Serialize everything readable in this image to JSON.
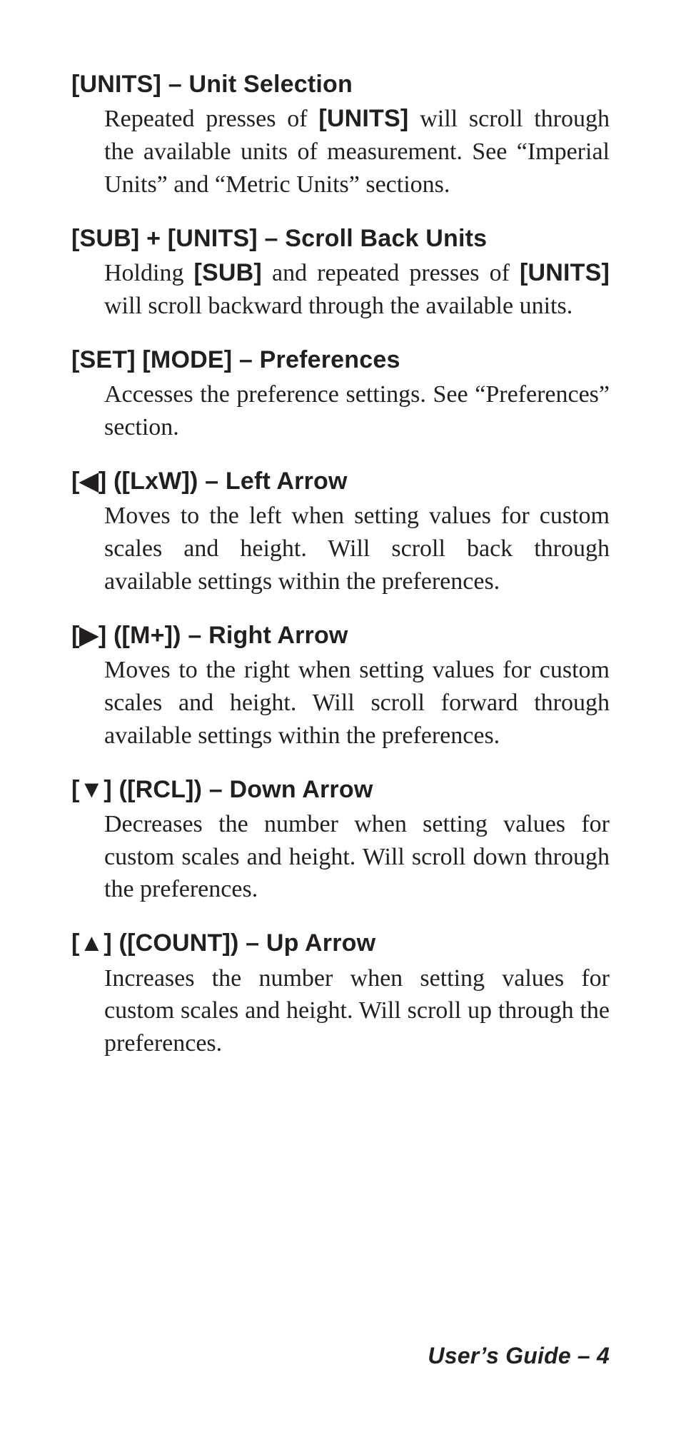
{
  "entries": [
    {
      "heading": "[UNITS] – Unit Selection",
      "body_html": "Repeated presses of <b>[UNITS]</b> will scroll through the available units of measurement. See “Imperial Units” and “Metric Units” sections."
    },
    {
      "heading": "[SUB] + [UNITS] – Scroll Back Units",
      "body_html": "Holding <b>[SUB]</b> and repeated presses of <b>[UNITS]</b> will scroll backward through the available units."
    },
    {
      "heading": "[SET] [MODE] – Preferences",
      "body_html": "Accesses the preference settings. See “Preferences” section."
    },
    {
      "heading": "[◀] ([LxW]) – Left Arrow",
      "body_html": "Moves to the left when setting values for custom scales and height. Will scroll back through available settings within the preferences."
    },
    {
      "heading": "[▶] ([M+]) – Right Arrow",
      "body_html": "Moves to the right when setting values for custom scales and height. Will scroll forward through available settings within the preferences."
    },
    {
      "heading": "[▼] ([RCL]) – Down Arrow",
      "body_html": "Decreases the number when setting values for custom scales and height. Will scroll down through the preferences."
    },
    {
      "heading": "[▲] ([COUNT]) – Up Arrow",
      "body_html": "Increases the number when setting values for custom scales and height. Will scroll up through the preferences."
    }
  ],
  "footer": "User’s Guide – 4"
}
